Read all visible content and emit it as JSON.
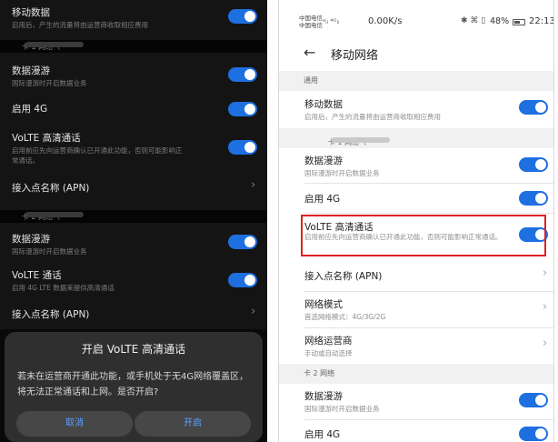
{
  "left": {
    "mobile_data": {
      "title": "移动数据",
      "subtitle": "启用后，产生的流量将由运营商收取相应费用"
    },
    "sim1_header": "卡 1 网络（",
    "sim1": {
      "roaming": {
        "title": "数据漫游",
        "subtitle": "国际漫游时开启数据业务"
      },
      "enable_4g": {
        "title": "启用 4G"
      },
      "volte": {
        "title": "VoLTE 高清通话",
        "subtitle_line1": "启用前应先向运营商确认已开通此功能，否则可能影响正",
        "subtitle_line2": "常通话。"
      },
      "apn": {
        "title": "接入点名称 (APN)"
      }
    },
    "sim2_header": "卡 2 网络（",
    "sim2": {
      "roaming": {
        "title": "数据漫游",
        "subtitle": "国际漫游时开启数据业务"
      },
      "volte": {
        "title": "VoLTE 通话",
        "subtitle": "启用 4G LTE 数据来提供高清通话"
      },
      "apn": {
        "title": "接入点名称 (APN)"
      }
    },
    "dialog": {
      "title": "开启 VoLTE 高清通话",
      "message": "若未在运营商开通此功能，或手机处于无4G网络覆盖区，将无法正常通话和上网。是否开启?",
      "cancel_label": "取消",
      "confirm_label": "开启"
    }
  },
  "right": {
    "status": {
      "carrier_line1": "中国电信",
      "carrier_line2": "中国电信",
      "signal": "ᵃᵢₗ ⁴ᴳᵢₗ",
      "netspeed": "0.00K/s",
      "icons": "✱ ⌘ ▯",
      "battery": "48%",
      "time": "22:13"
    },
    "title": "移动网络",
    "general_header": "通用",
    "mobile_data": {
      "title": "移动数据",
      "subtitle": "启用后，产生的流量将由运营商收取相应费用"
    },
    "sim1_header": "卡 1 网络（",
    "sim1": {
      "roaming": {
        "title": "数据漫游",
        "subtitle": "国际漫游时开启数据业务"
      },
      "enable_4g": {
        "title": "启用 4G"
      },
      "volte": {
        "title": "VoLTE 高清通话",
        "subtitle": "启用前应先向运营商确认已开通此功能，否则可能影响正常通话。"
      },
      "apn": {
        "title": "接入点名称 (APN)"
      },
      "network_mode": {
        "title": "网络模式",
        "subtitle": "首选网络模式：4G/3G/2G"
      },
      "operator": {
        "title": "网络运营商",
        "subtitle": "手动或自动选择"
      }
    },
    "sim2_header": "卡 2 网络",
    "sim2": {
      "roaming": {
        "title": "数据漫游",
        "subtitle": "国际漫游时开启数据业务"
      },
      "enable_4g": {
        "title": "启用 4G"
      }
    }
  },
  "colors": {
    "toggle_on": "#1e6fe0",
    "highlight": "#e02020",
    "dark_bg": "#141414"
  }
}
